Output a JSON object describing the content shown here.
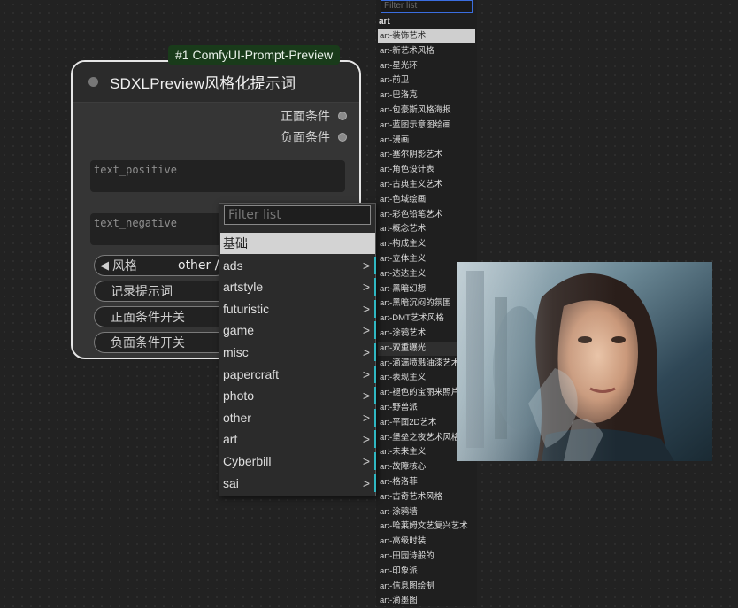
{
  "node": {
    "badge": "#1 ComfyUI-Prompt-Preview",
    "title": "SDXLPreview风格化提示词",
    "outputs": [
      "正面条件",
      "负面条件"
    ],
    "text_positive_placeholder": "text_positive",
    "text_negative_placeholder": "text_negative",
    "style_label": "风格",
    "style_value": "other /",
    "style_arrow": "◀",
    "widgets": [
      "记录提示词",
      "正面条件开关",
      "负面条件开关"
    ]
  },
  "context_menu": {
    "filter_placeholder": "Filter list",
    "items": [
      {
        "label": "基础",
        "submenu": false
      },
      {
        "label": "ads",
        "submenu": true
      },
      {
        "label": "artstyle",
        "submenu": true
      },
      {
        "label": "futuristic",
        "submenu": true
      },
      {
        "label": "game",
        "submenu": true
      },
      {
        "label": "misc",
        "submenu": true
      },
      {
        "label": "papercraft",
        "submenu": true
      },
      {
        "label": "photo",
        "submenu": true
      },
      {
        "label": "other",
        "submenu": true
      },
      {
        "label": "art",
        "submenu": true
      },
      {
        "label": "Cyberbill",
        "submenu": true
      },
      {
        "label": "sai",
        "submenu": true
      }
    ],
    "arrow_glyph": ">"
  },
  "style_list": {
    "filter_placeholder": "Filter list",
    "heading": "art",
    "items": [
      "art-装饰艺术",
      "art-新艺术风格",
      "art-星光环",
      "art-前卫",
      "art-巴洛克",
      "art-包豪斯风格海报",
      "art-蓝图示意图绘画",
      "art-漫画",
      "art-塞尔阴影艺术",
      "art-角色设计表",
      "art-古典主义艺术",
      "art-色域绘画",
      "art-彩色铅笔艺术",
      "art-概念艺术",
      "art-构成主义",
      "art-立体主义",
      "art-达达主义",
      "art-黑暗幻想",
      "art-黑暗沉闷的氛围",
      "art-DMT艺术风格",
      "art-涂鸦艺术",
      "art-双重曝光",
      "art-滴漏喷溅油漆艺术",
      "art-表现主义",
      "art-褪色的宝丽来照片",
      "art-野兽派",
      "art-平面2D艺术",
      "art-堡垒之夜艺术风格",
      "art-未来主义",
      "art-故障核心",
      "art-格洛菲",
      "art-古奇艺术风格",
      "art-涂鸦墙",
      "art-哈莱姆文艺复兴艺术",
      "art-高级时装",
      "art-田园诗般的",
      "art-印象派",
      "art-信息图绘制",
      "art-滴墨图"
    ],
    "selected_index": 0,
    "hovered_index": 21
  },
  "preview": {
    "alt": "art-双重曝光"
  },
  "colors": {
    "canvas": "#222222",
    "node_border": "#e6e6e6",
    "badge_bg": "#193b1a",
    "accent_teal": "#2fb7c2",
    "filter_focus": "#3b6ee0"
  }
}
